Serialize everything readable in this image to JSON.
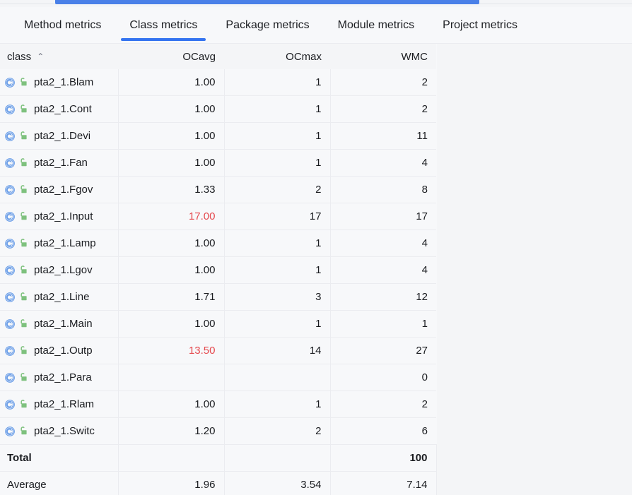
{
  "colors": {
    "accent": "#3574f0",
    "progress": "#4a80e8",
    "warn_text": "#e5484d",
    "class_icon": "#6c9fe8",
    "lock_icon": "#7ec17e",
    "grid_line": "#ebecf0",
    "table_bg": "#f7f8fa",
    "page_bg": "#f4f5f7"
  },
  "tabs": [
    {
      "label": "Method metrics",
      "selected": false
    },
    {
      "label": "Class metrics",
      "selected": true
    },
    {
      "label": "Package metrics",
      "selected": false
    },
    {
      "label": "Module metrics",
      "selected": false
    },
    {
      "label": "Project metrics",
      "selected": false
    }
  ],
  "table": {
    "sort_column": "class",
    "sort_direction": "ascending",
    "sort_caret": "⌃",
    "columns": [
      {
        "key": "class",
        "label": "class",
        "align": "left"
      },
      {
        "key": "ocavg",
        "label": "OCavg",
        "align": "right"
      },
      {
        "key": "ocmax",
        "label": "OCmax",
        "align": "right"
      },
      {
        "key": "wmc",
        "label": "WMC",
        "align": "right"
      }
    ],
    "row_icons": {
      "class_icon": "class-icon",
      "visibility_icon": "unlocked-padlock-icon"
    },
    "rows": [
      {
        "class": "pta2_1.Blam",
        "ocavg": "1.00",
        "ocavg_warn": false,
        "ocmax": "1",
        "wmc": "2"
      },
      {
        "class": "pta2_1.Cont",
        "ocavg": "1.00",
        "ocavg_warn": false,
        "ocmax": "1",
        "wmc": "2"
      },
      {
        "class": "pta2_1.Devi",
        "ocavg": "1.00",
        "ocavg_warn": false,
        "ocmax": "1",
        "wmc": "11"
      },
      {
        "class": "pta2_1.Fan",
        "ocavg": "1.00",
        "ocavg_warn": false,
        "ocmax": "1",
        "wmc": "4"
      },
      {
        "class": "pta2_1.Fgov",
        "ocavg": "1.33",
        "ocavg_warn": false,
        "ocmax": "2",
        "wmc": "8"
      },
      {
        "class": "pta2_1.Input",
        "ocavg": "17.00",
        "ocavg_warn": true,
        "ocmax": "17",
        "wmc": "17"
      },
      {
        "class": "pta2_1.Lamp",
        "ocavg": "1.00",
        "ocavg_warn": false,
        "ocmax": "1",
        "wmc": "4"
      },
      {
        "class": "pta2_1.Lgov",
        "ocavg": "1.00",
        "ocavg_warn": false,
        "ocmax": "1",
        "wmc": "4"
      },
      {
        "class": "pta2_1.Line",
        "ocavg": "1.71",
        "ocavg_warn": false,
        "ocmax": "3",
        "wmc": "12"
      },
      {
        "class": "pta2_1.Main",
        "ocavg": "1.00",
        "ocavg_warn": false,
        "ocmax": "1",
        "wmc": "1"
      },
      {
        "class": "pta2_1.Outp",
        "ocavg": "13.50",
        "ocavg_warn": true,
        "ocmax": "14",
        "wmc": "27"
      },
      {
        "class": "pta2_1.Para",
        "ocavg": "",
        "ocavg_warn": false,
        "ocmax": "",
        "wmc": "0"
      },
      {
        "class": "pta2_1.Rlam",
        "ocavg": "1.00",
        "ocavg_warn": false,
        "ocmax": "1",
        "wmc": "2"
      },
      {
        "class": "pta2_1.Switc",
        "ocavg": "1.20",
        "ocavg_warn": false,
        "ocmax": "2",
        "wmc": "6"
      }
    ],
    "summary": [
      {
        "label": "Total",
        "bold": true,
        "ocavg": "",
        "ocmax": "",
        "wmc": "100"
      },
      {
        "label": "Average",
        "bold": false,
        "ocavg": "1.96",
        "ocmax": "3.54",
        "wmc": "7.14"
      }
    ]
  }
}
